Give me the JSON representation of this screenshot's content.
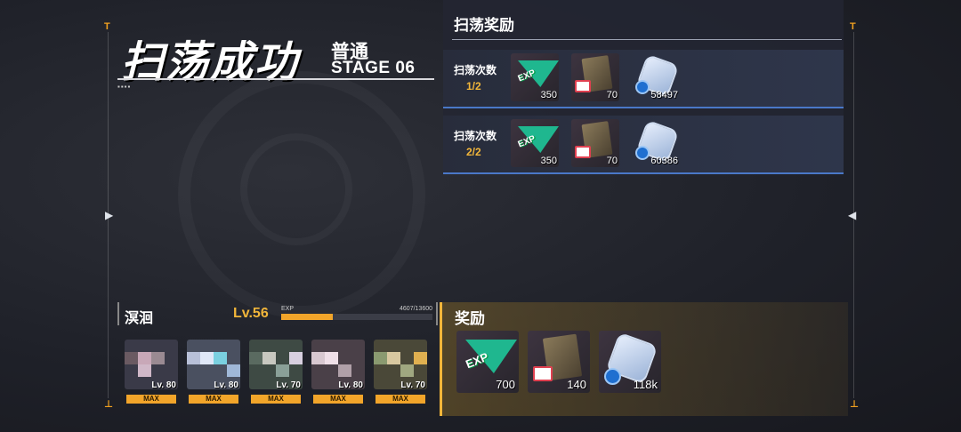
{
  "header": {
    "title": "扫荡成功",
    "difficulty": "普通",
    "stage": "STAGE 06"
  },
  "sweep_rewards": {
    "title": "扫荡奖励",
    "runs": [
      {
        "label": "扫荡次数",
        "count": "1/2",
        "items": [
          {
            "icon": "exp-ticket-icon",
            "qty": "350"
          },
          {
            "icon": "document-card-icon",
            "qty": "70"
          },
          {
            "icon": "credit-chip-icon",
            "qty": "58497"
          }
        ]
      },
      {
        "label": "扫荡次数",
        "count": "2/2",
        "items": [
          {
            "icon": "exp-ticket-icon",
            "qty": "350"
          },
          {
            "icon": "document-card-icon",
            "qty": "70"
          },
          {
            "icon": "credit-chip-icon",
            "qty": "60386"
          }
        ]
      }
    ]
  },
  "character": {
    "name": "溟洄",
    "level": "Lv.56",
    "exp_label": "EXP",
    "exp_value": "4607/13600",
    "exp_progress": 0.339
  },
  "team": [
    {
      "level": "Lv. 80",
      "max": "MAX"
    },
    {
      "level": "Lv. 80",
      "max": "MAX"
    },
    {
      "level": "Lv. 70",
      "max": "MAX"
    },
    {
      "level": "Lv. 80",
      "max": "MAX"
    },
    {
      "level": "Lv. 70",
      "max": "MAX"
    }
  ],
  "rewards": {
    "title": "奖励",
    "items": [
      {
        "icon": "exp-ticket-icon",
        "qty": "700"
      },
      {
        "icon": "document-card-icon",
        "qty": "140"
      },
      {
        "icon": "credit-chip-icon",
        "qty": "118k"
      }
    ]
  },
  "exp_icon_text": "EXP",
  "colors": {
    "accent": "#f2b63a",
    "exp_green": "#1fb78f",
    "rule_blue": "#4a78c8"
  }
}
